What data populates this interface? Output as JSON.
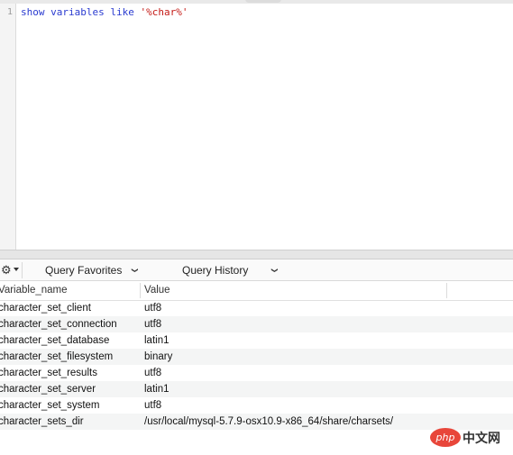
{
  "editor": {
    "line_numbers": [
      "1"
    ],
    "code": {
      "kw1": "show",
      "kw2": "variables",
      "kw3": "like",
      "str": "'%char%'"
    }
  },
  "toolbar": {
    "gear_icon": "gear-icon",
    "query_favorites_label": "Query Favorites",
    "query_history_label": "Query History",
    "chevron": "⌄"
  },
  "results": {
    "columns": [
      "Variable_name",
      "Value"
    ],
    "rows": [
      [
        "character_set_client",
        "utf8"
      ],
      [
        "character_set_connection",
        "utf8"
      ],
      [
        "character_set_database",
        "latin1"
      ],
      [
        "character_set_filesystem",
        "binary"
      ],
      [
        "character_set_results",
        "utf8"
      ],
      [
        "character_set_server",
        "latin1"
      ],
      [
        "character_set_system",
        "utf8"
      ],
      [
        "character_sets_dir",
        "/usr/local/mysql-5.7.9-osx10.9-x86_64/share/charsets/"
      ]
    ]
  },
  "watermark": {
    "logo_text": "php",
    "site_text": "中文网"
  },
  "colors": {
    "keyword": "#2a3bd0",
    "string": "#c41a16",
    "row_alt": "#f4f5f5"
  }
}
